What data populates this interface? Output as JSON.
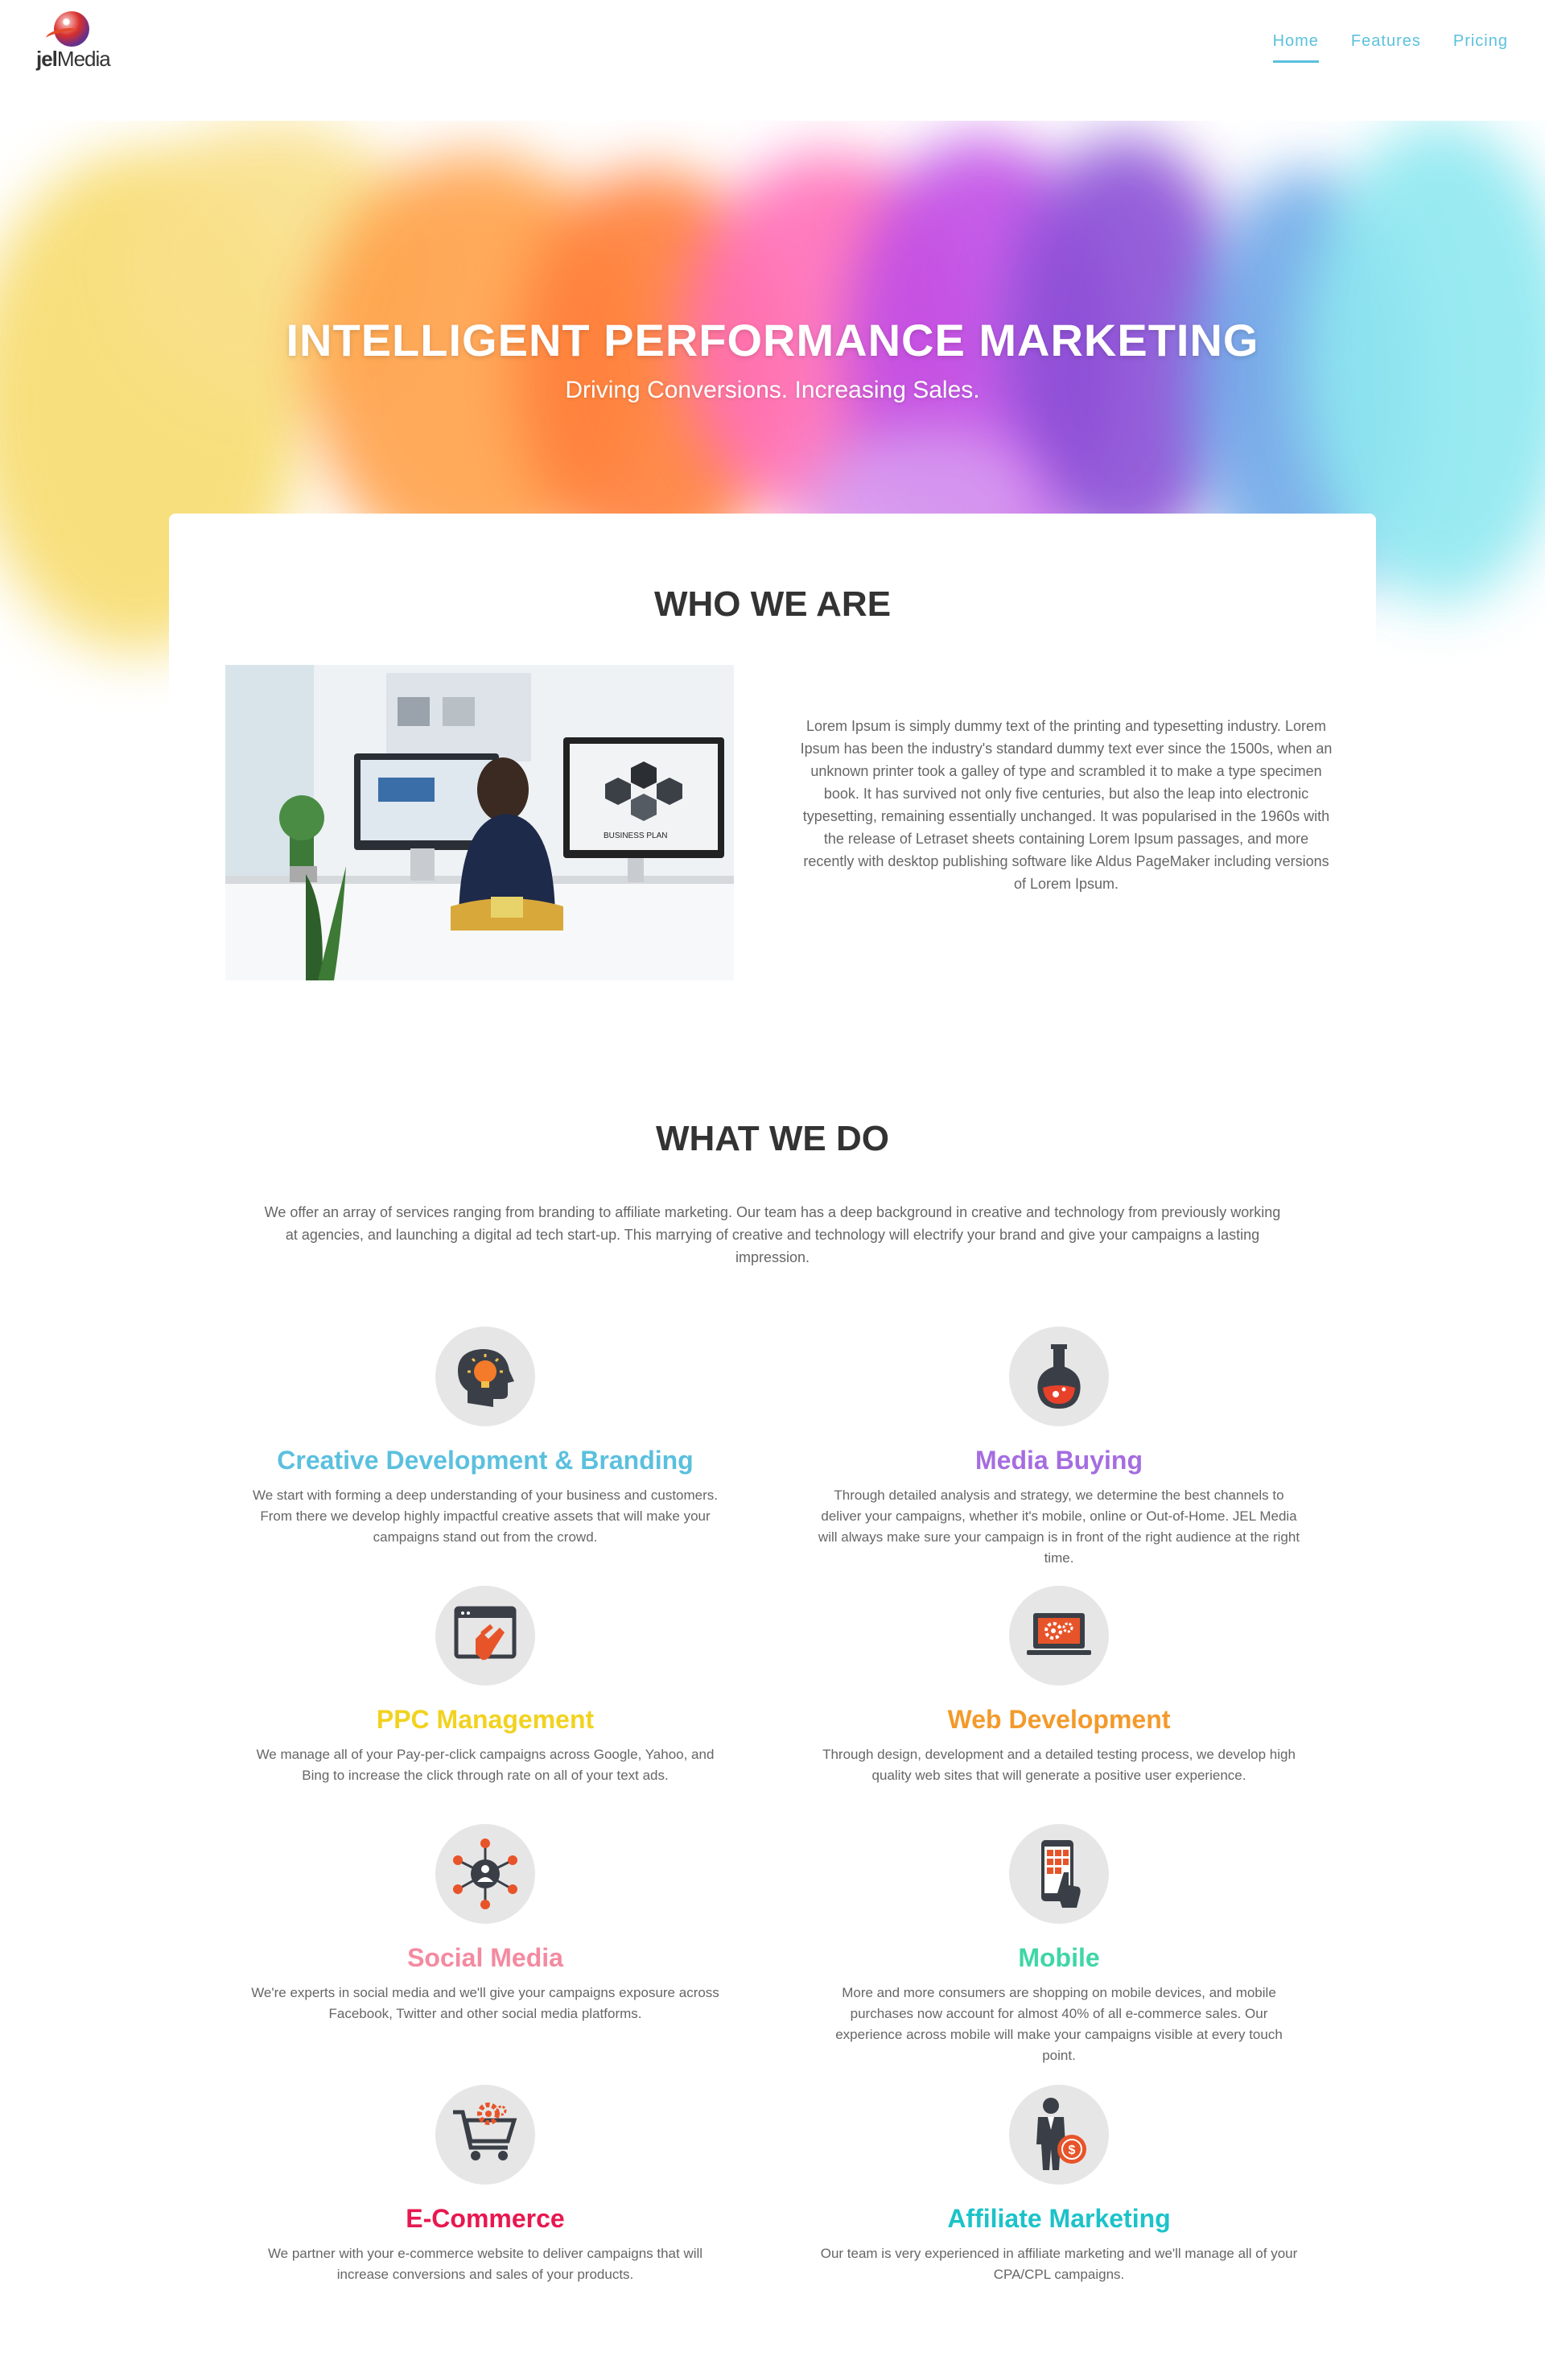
{
  "brand": {
    "logo_bold": "jel",
    "logo_rest": "Media"
  },
  "nav": {
    "items": [
      "Home",
      "Features",
      "Pricing"
    ]
  },
  "hero": {
    "title": "INTELLIGENT PERFORMANCE MARKETING",
    "subtitle": "Driving Conversions. Increasing Sales."
  },
  "who": {
    "title": "WHO WE ARE",
    "text": "Lorem Ipsum is simply dummy text of the printing and typesetting industry. Lorem Ipsum has been the industry's standard dummy text ever since the 1500s, when an unknown printer took a galley of type and scrambled it to make a type specimen book. It has survived not only five centuries, but also the leap into electronic typesetting, remaining essentially unchanged. It was popularised in the 1960s with the release of Letraset sheets containing Lorem Ipsum passages, and more recently with desktop publishing software like Aldus PageMaker including versions of Lorem Ipsum.",
    "image_text": "BUSINESS PLAN"
  },
  "what": {
    "title": "WHAT WE DO",
    "intro": "We offer an array of services ranging from branding to affiliate marketing. Our team has a deep background in creative and technology from previously working at agencies, and launching a digital ad tech start-up. This marrying of creative and technology will electrify your brand and give your campaigns a lasting impression."
  },
  "services": [
    {
      "title": "Creative Development & Branding",
      "color": "#5bc0de",
      "icon": "head-lightbulb-icon",
      "text": "We start with forming a deep understanding of your business and customers. From there we develop highly impactful creative assets that will make your campaigns stand out from the crowd."
    },
    {
      "title": "Media Buying",
      "color": "#a56de0",
      "icon": "flask-icon",
      "text": "Through detailed analysis and strategy, we determine the best channels to deliver your campaigns, whether it's mobile, online or Out-of-Home. JEL Media will always make sure your campaign is in front of the right audience at the right time."
    },
    {
      "title": "PPC Management",
      "color": "#f2d21f",
      "icon": "click-window-icon",
      "text": "We manage all of your Pay-per-click campaigns across Google, Yahoo, and Bing to increase the click through rate on all of your text ads."
    },
    {
      "title": "Web Development",
      "color": "#f39a2b",
      "icon": "laptop-gears-icon",
      "text": "Through design, development and a detailed testing process, we develop high quality web sites that will generate a positive user experience."
    },
    {
      "title": "Social Media",
      "color": "#f48aa0",
      "icon": "network-people-icon",
      "text": "We're experts in social media and we'll give your campaigns exposure across Facebook, Twitter and other social media platforms."
    },
    {
      "title": "Mobile",
      "color": "#3fd6a6",
      "icon": "smartphone-touch-icon",
      "text": "More and more consumers are shopping on mobile devices, and mobile purchases now account for almost 40% of all e-commerce sales. Our experience across mobile will make your campaigns visible at every touch point."
    },
    {
      "title": "E-Commerce",
      "color": "#e8174f",
      "icon": "shopping-cart-icon",
      "text": "We partner with your e-commerce website to deliver campaigns that will increase conversions and sales of your products."
    },
    {
      "title": "Affiliate Marketing",
      "color": "#1cc3c9",
      "icon": "businessman-dollar-icon",
      "text": "Our team is very experienced in affiliate marketing and we'll manage all of your CPA/CPL campaigns."
    }
  ]
}
